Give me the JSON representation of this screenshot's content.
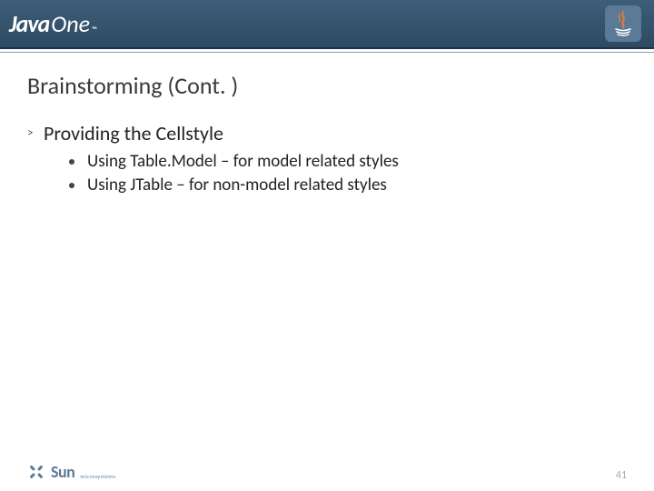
{
  "header": {
    "logo_left_primary": "Java",
    "logo_left_secondary": "One",
    "logo_left_tm": "™",
    "logo_right_name": "Java"
  },
  "title": "Brainstorming (Cont. )",
  "bullets": {
    "l1": {
      "marker": ">",
      "text": "Providing the Cellstyle"
    },
    "l2": [
      "Using Table.Model – for model related styles",
      "Using JTable – for non-model related styles"
    ]
  },
  "footer": {
    "sun_word": "Sun",
    "sun_micro": "microsystems",
    "page_number": "41"
  }
}
